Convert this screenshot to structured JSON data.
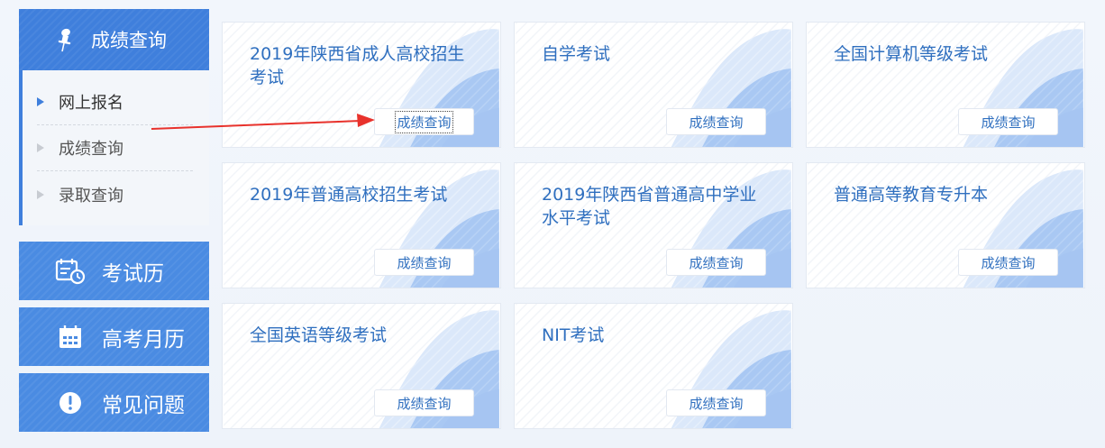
{
  "sidebar": {
    "header": {
      "label": "成绩查询",
      "icon": "pin-icon"
    },
    "submenu": [
      {
        "label": "网上报名",
        "active": true
      },
      {
        "label": "成绩查询",
        "active": false
      },
      {
        "label": "录取查询",
        "active": false
      }
    ],
    "buttons": [
      {
        "label": "考试历",
        "icon": "calendar-clock-icon"
      },
      {
        "label": "高考月历",
        "icon": "calendar-icon"
      },
      {
        "label": "常见问题",
        "icon": "exclamation-icon"
      }
    ]
  },
  "cards": [
    {
      "title": "2019年陕西省成人高校招生考试",
      "button": "成绩查询"
    },
    {
      "title": "自学考试",
      "button": "成绩查询"
    },
    {
      "title": "全国计算机等级考试",
      "button": "成绩查询"
    },
    {
      "title": "2019年普通高校招生考试",
      "button": "成绩查询"
    },
    {
      "title": "2019年陕西省普通高中学业水平考试",
      "button": "成绩查询"
    },
    {
      "title": "普通高等教育专升本",
      "button": "成绩查询"
    },
    {
      "title": "全国英语等级考试",
      "button": "成绩查询"
    },
    {
      "title": "NIT考试",
      "button": "成绩查询"
    }
  ],
  "colors": {
    "primary": "#3f7fdc",
    "button_blue": "#4a8be2",
    "title_blue": "#2f6fbf",
    "annotation_arrow": "#e8322c"
  }
}
